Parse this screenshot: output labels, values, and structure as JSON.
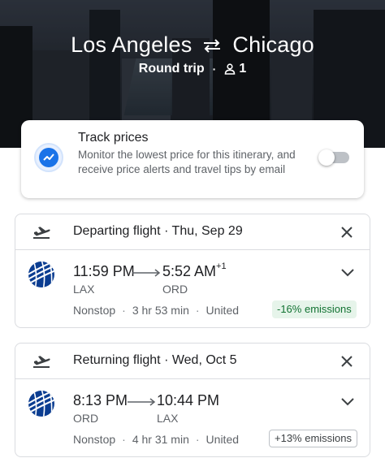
{
  "hero": {
    "origin": "Los Angeles",
    "destination": "Chicago",
    "swap_icon": "swap-arrows-icon",
    "trip_type": "Round trip",
    "separator": "·",
    "passenger_icon": "person-icon",
    "passengers": "1"
  },
  "track_prices": {
    "icon": "trending-icon",
    "title": "Track prices",
    "description": "Monitor the lowest price for this itinerary, and receive price alerts and travel tips by email",
    "toggle_on": false
  },
  "flights": [
    {
      "header": "Departing flight · Thu, Sep 29",
      "icon": "takeoff-icon",
      "depart_time": "11:59 PM",
      "arrive_time": "5:52 AM",
      "arrive_offset": "+1",
      "depart_code": "LAX",
      "arrive_code": "ORD",
      "stops": "Nonstop",
      "duration": "3 hr 53 min",
      "airline": "United",
      "emissions": "-16% emissions",
      "emissions_color": "#137333"
    },
    {
      "header": "Returning flight · Wed, Oct 5",
      "icon": "takeoff-icon",
      "depart_time": "8:13 PM",
      "arrive_time": "10:44 PM",
      "arrive_offset": "",
      "depart_code": "ORD",
      "arrive_code": "LAX",
      "stops": "Nonstop",
      "duration": "4 hr 31 min",
      "airline": "United",
      "emissions": "+13% emissions",
      "emissions_color": "#3c4043"
    }
  ],
  "separator": "·",
  "colors": {
    "accent": "#1a73e8",
    "low_emissions_bg": "#e6f4ea",
    "united_blue": "#0b3d91"
  }
}
